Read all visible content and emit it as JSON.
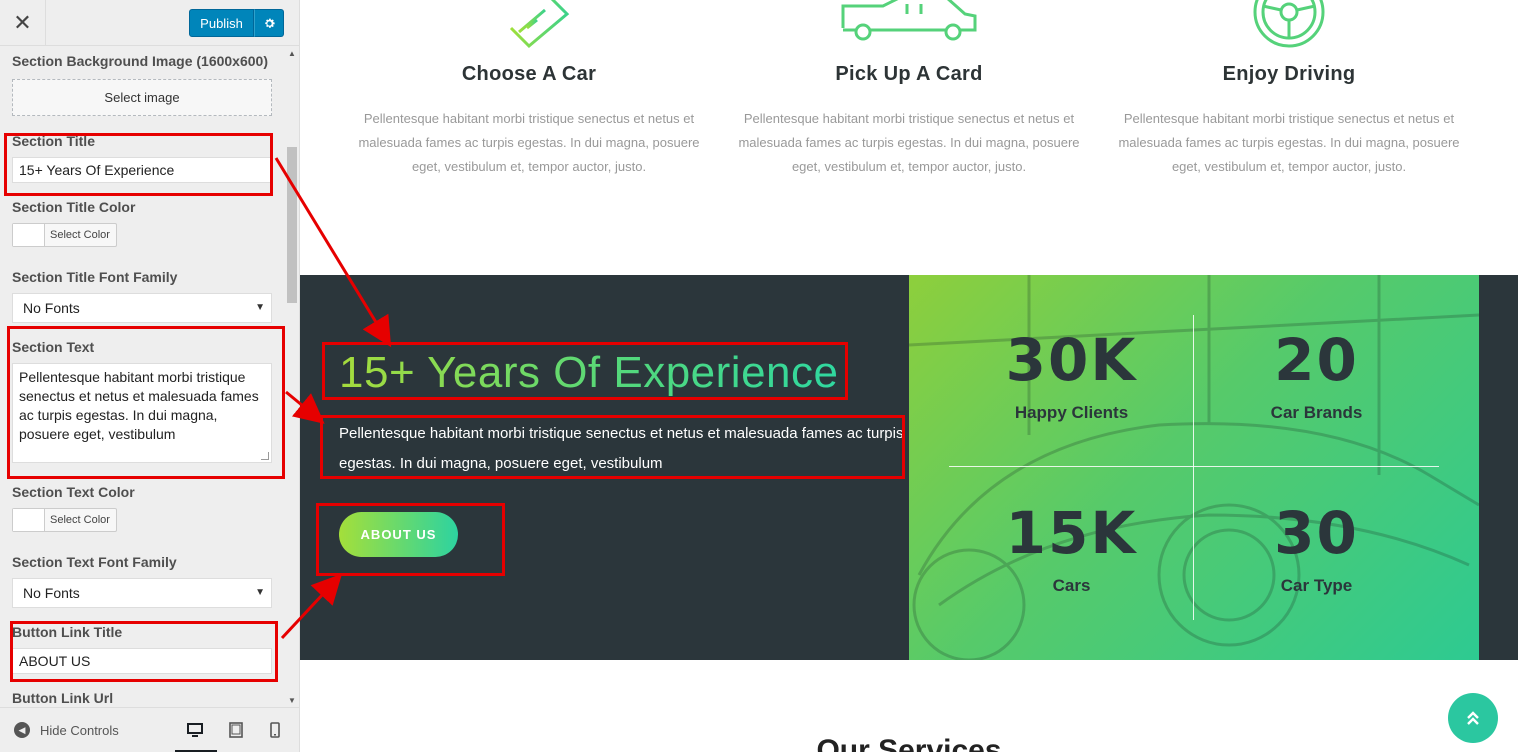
{
  "customizer": {
    "close_icon": "close-icon",
    "publish_label": "Publish",
    "settings_icon": "gear-icon",
    "controls": {
      "bg_image_label": "Section Background Image (1600x600)",
      "select_image_label": "Select image",
      "title_label": "Section Title",
      "title_value": "15+ Years Of Experience",
      "title_color_label": "Section Title Color",
      "select_color_label": "Select Color",
      "title_font_label": "Section Title Font Family",
      "title_font_value": "No Fonts",
      "text_label": "Section Text",
      "text_value": "Pellentesque habitant morbi tristique senectus et netus et malesuada fames ac turpis egestas. In dui magna, posuere eget, vestibulum",
      "text_color_label": "Section Text Color",
      "text_font_label": "Section Text Font Family",
      "text_font_value": "No Fonts",
      "button_title_label": "Button Link Title",
      "button_title_value": "ABOUT US",
      "button_url_label": "Button Link Url"
    },
    "footer": {
      "hide_controls_label": "Hide Controls",
      "devices": [
        "desktop",
        "tablet",
        "mobile"
      ],
      "active_device": "desktop"
    }
  },
  "preview": {
    "features": [
      {
        "icon": "credit-card-icon",
        "title": "Choose A Car",
        "text": "Pellentesque habitant morbi tristique senectus et netus et malesuada fames ac turpis egestas. In dui magna, posuere eget, vestibulum et, tempor auctor, justo."
      },
      {
        "icon": "car-icon",
        "title": "Pick Up A Card",
        "text": "Pellentesque habitant morbi tristique senectus et netus et malesuada fames ac turpis egestas. In dui magna, posuere eget, vestibulum et, tempor auctor, justo."
      },
      {
        "icon": "steering-wheel-icon",
        "title": "Enjoy Driving",
        "text": "Pellentesque habitant morbi tristique senectus et netus et malesuada fames ac turpis egestas. In dui magna, posuere eget, vestibulum et, tempor auctor, justo."
      }
    ],
    "experience": {
      "title": "15+ Years Of Experience",
      "text_line1": "Pellentesque habitant morbi tristique senectus et netus et malesuada fames ac turpis",
      "text_line2": "egestas. In dui magna, posuere eget, vestibulum",
      "button": "ABOUT US"
    },
    "stats": [
      {
        "value": "30K",
        "label": "Happy Clients"
      },
      {
        "value": "20",
        "label": "Car Brands"
      },
      {
        "value": "15K",
        "label": "Cars"
      },
      {
        "value": "30",
        "label": "Car Type"
      }
    ],
    "services_heading": "Our Services",
    "scroll_top_icon": "double-chevron-up-icon"
  },
  "colors": {
    "annotation": "#e60000",
    "publish": "#0085ba",
    "band": "#2b363b",
    "accent_start": "#a6dc3c",
    "accent_end": "#2fd8a0",
    "scroll_top": "#2bc7a0"
  }
}
